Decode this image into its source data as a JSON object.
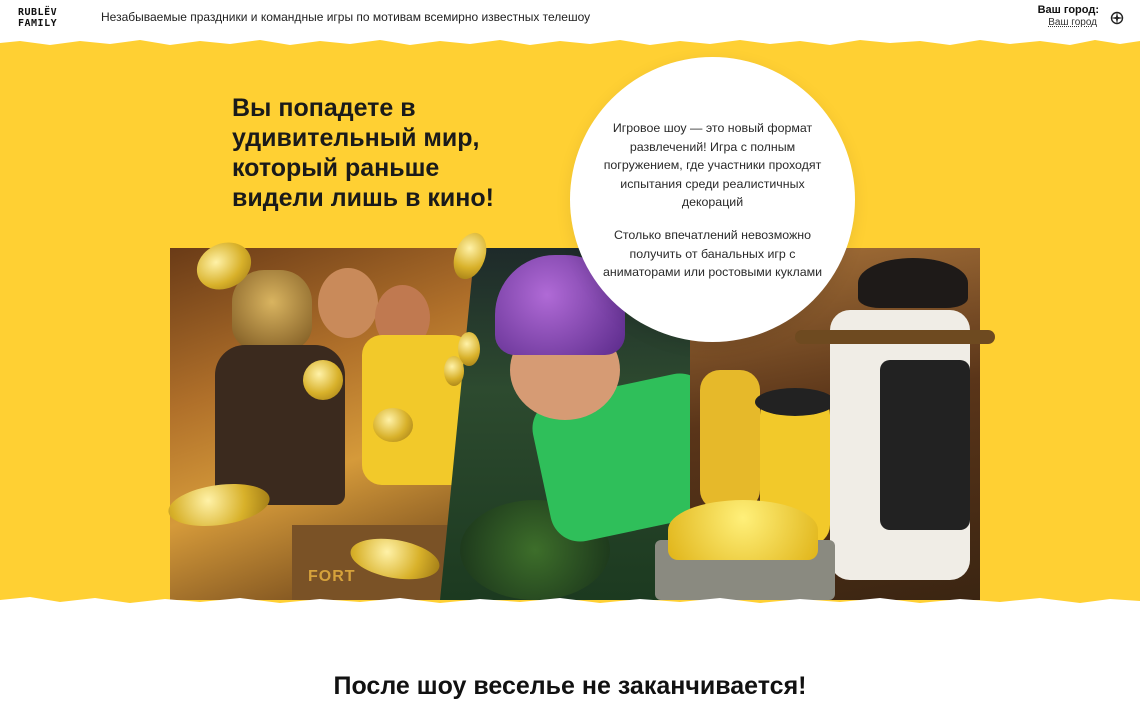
{
  "header": {
    "logo_line1": "RUBLËV",
    "logo_line2": "FAMILY",
    "tagline": "Незабываемые праздники и командные игры по мотивам всемирно известных телешоу",
    "city_label": "Ваш город:",
    "city_link": "Ваш город"
  },
  "hero": {
    "headline": "Вы попадете в удивительный мир, который раньше видели лишь в кино!",
    "bubble_paragraph_1": "Игровое шоу — это новый формат развлечений! Игра с полным погружением, где участники проходят испытания среди реалистичных декораций",
    "bubble_paragraph_2": "Столько впечатлений невозможно получить от банальных игр с аниматорами или ростовыми куклами",
    "chest_label": "FORT",
    "background_color": "#ffd033"
  },
  "next_section": {
    "title": "После шоу веселье не заканчивается!"
  },
  "icons": {
    "city_selector": "compass-icon"
  }
}
